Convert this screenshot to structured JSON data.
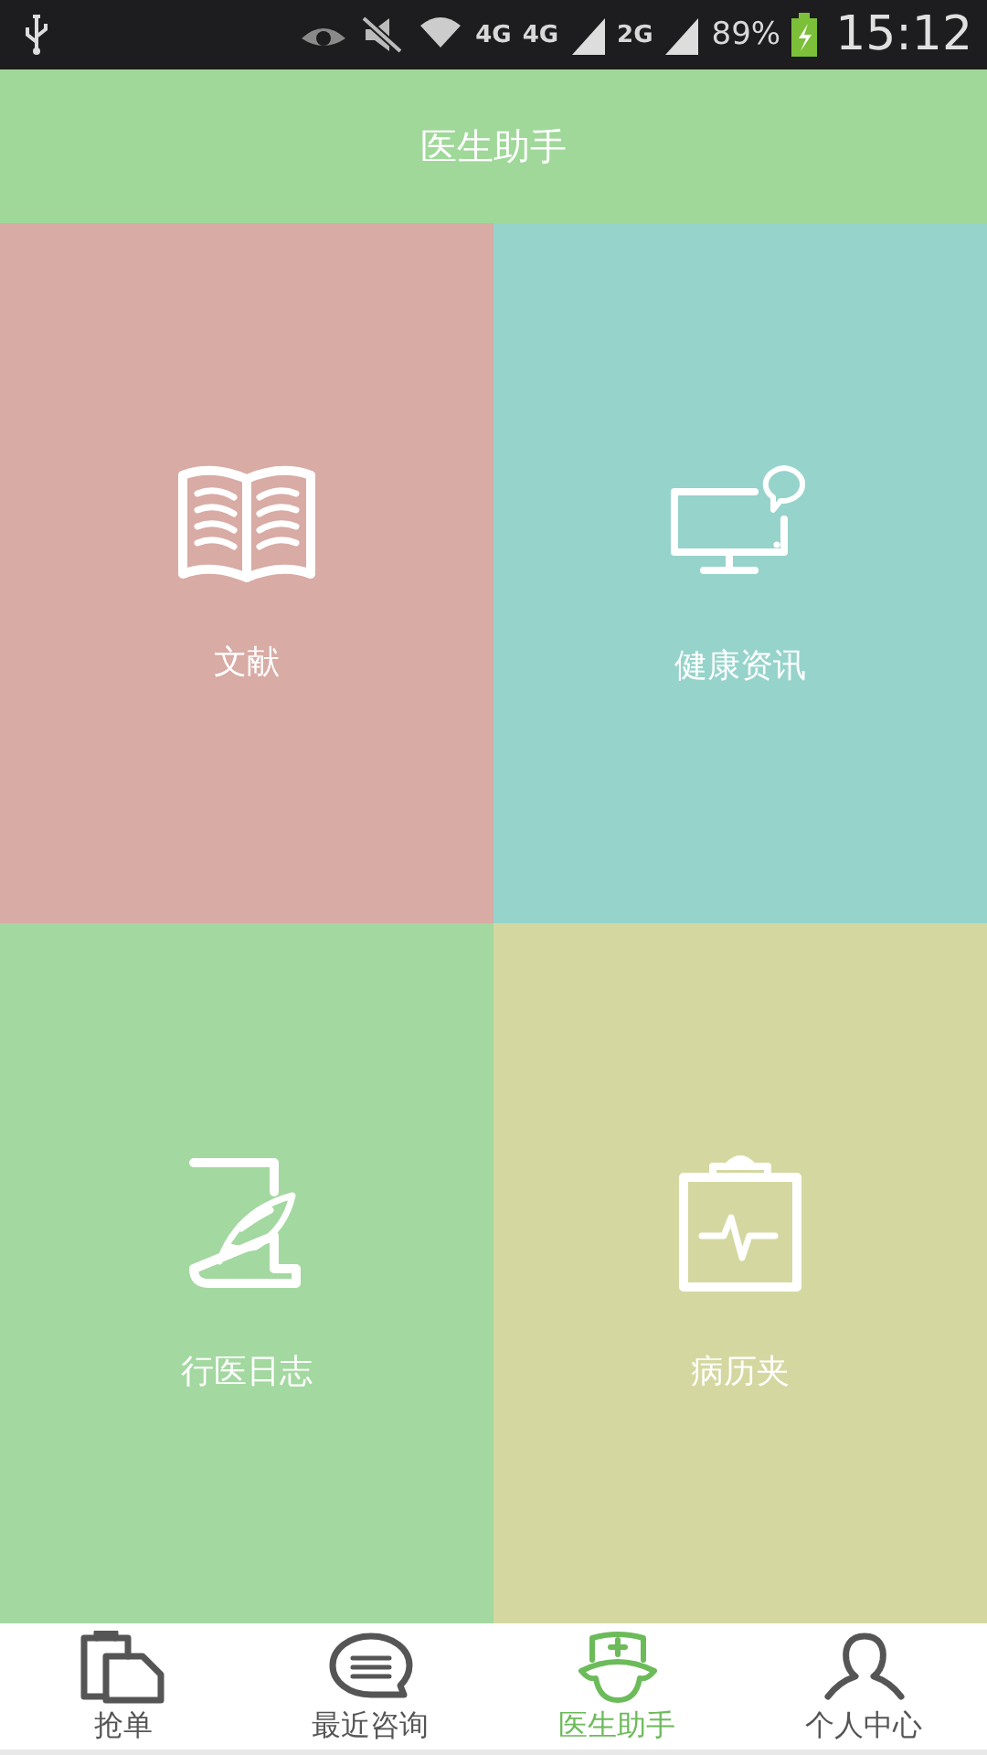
{
  "status_bar": {
    "network_labels": [
      "4G",
      "4G",
      "2G"
    ],
    "battery": "89%",
    "time": "15:12"
  },
  "header": {
    "title": "医生助手"
  },
  "tiles": [
    {
      "label": "文献",
      "kind": "book",
      "color": "#d8aba5"
    },
    {
      "label": "健康资讯",
      "kind": "monitor",
      "color": "#96d3cb"
    },
    {
      "label": "行医日志",
      "kind": "journal",
      "color": "#a3d8a0"
    },
    {
      "label": "病历夹",
      "kind": "clipboard",
      "color": "#d4d8a0"
    }
  ],
  "bottom_nav": [
    {
      "label": "抢单",
      "kind": "orders",
      "selected": false
    },
    {
      "label": "最近咨询",
      "kind": "chat",
      "selected": false
    },
    {
      "label": "医生助手",
      "kind": "nurse",
      "selected": true
    },
    {
      "label": "个人中心",
      "kind": "person",
      "selected": false
    }
  ]
}
